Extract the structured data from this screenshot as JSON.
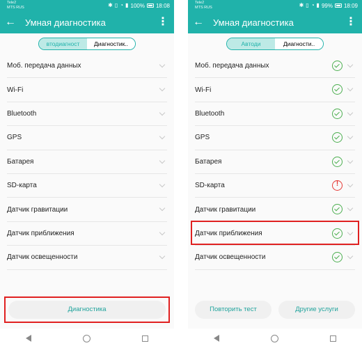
{
  "colors": {
    "accent": "#20b2aa",
    "ok": "#4caf50",
    "error": "#e53935",
    "highlight": "#e02020"
  },
  "left": {
    "statusbar": {
      "carrier1": "Tele2",
      "carrier2": "MTS RUS",
      "battery": "100%",
      "time": "18:08"
    },
    "appbar": {
      "title": "Умная диагностика"
    },
    "tabs": [
      {
        "label": "втодиагност"
      },
      {
        "label": "Диагностик.."
      }
    ],
    "items": [
      {
        "label": "Моб. передача данных"
      },
      {
        "label": "Wi-Fi"
      },
      {
        "label": "Bluetooth"
      },
      {
        "label": "GPS"
      },
      {
        "label": "Батарея"
      },
      {
        "label": "SD-карта"
      },
      {
        "label": "Датчик гравитации"
      },
      {
        "label": "Датчик приближения"
      },
      {
        "label": "Датчик освещенности"
      }
    ],
    "button": "Диагностика"
  },
  "right": {
    "statusbar": {
      "carrier1": "Tele2",
      "carrier2": "MTS RUS",
      "battery": "99%",
      "time": "18:09"
    },
    "appbar": {
      "title": "Умная диагностика"
    },
    "tabs": [
      {
        "label": "Автоди"
      },
      {
        "label": "Диагности.."
      }
    ],
    "items": [
      {
        "label": "Моб. передача данных",
        "status": "ok"
      },
      {
        "label": "Wi-Fi",
        "status": "ok"
      },
      {
        "label": "Bluetooth",
        "status": "ok"
      },
      {
        "label": "GPS",
        "status": "ok"
      },
      {
        "label": "Батарея",
        "status": "ok"
      },
      {
        "label": "SD-карта",
        "status": "error"
      },
      {
        "label": "Датчик гравитации",
        "status": "ok"
      },
      {
        "label": "Датчик приближения",
        "status": "ok"
      },
      {
        "label": "Датчик освещенности",
        "status": "ok"
      }
    ],
    "buttons": {
      "retest": "Повторить тест",
      "other": "Другие услуги"
    }
  }
}
